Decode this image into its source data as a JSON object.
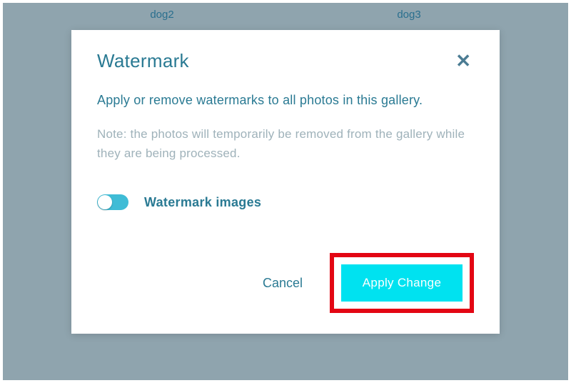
{
  "background": {
    "labels": [
      "dog2",
      "dog3"
    ]
  },
  "modal": {
    "title": "Watermark",
    "subtitle": "Apply or remove watermarks to all photos in this gallery.",
    "note": "Note: the photos will temporarily be removed from the gallery while they are being processed.",
    "toggle_label": "Watermark images",
    "cancel_label": "Cancel",
    "apply_label": "Apply Change"
  }
}
